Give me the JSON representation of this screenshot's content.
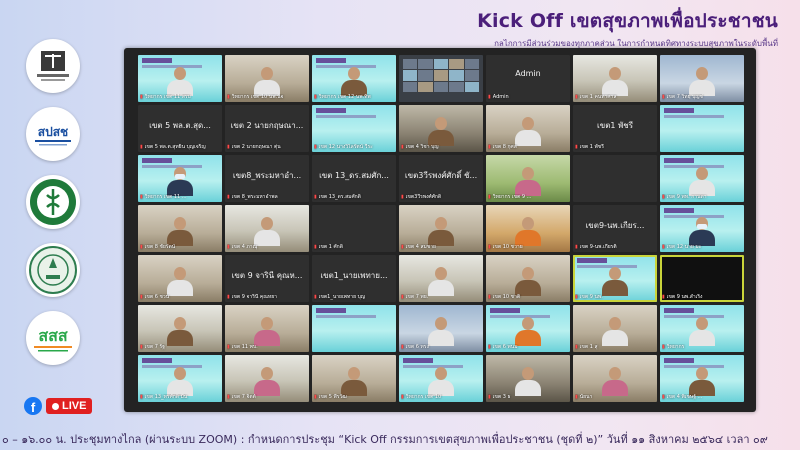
{
  "header": {
    "title": "Kick Off เขตสุขภาพเพื่อประชาชน",
    "subtitle": "กลไกการมีส่วนร่วมของทุกภาคส่วน ในการกำหนดทิศทางระบบสุขภาพในระดับพื้นที่"
  },
  "live": {
    "label": "LIVE"
  },
  "logos": [
    {
      "name": "national-health-commission-logo",
      "caption": "สำนักงานคณะกรรมการสุขภาพแห่งชาติ"
    },
    {
      "name": "nhso-logo",
      "caption": "สปสช"
    },
    {
      "name": "ministry-of-public-health-logo",
      "caption": ""
    },
    {
      "name": "bangkok-metropolitan-logo",
      "caption": ""
    },
    {
      "name": "thaihealth-logo",
      "caption": "สสส"
    }
  ],
  "tiles": [
    {
      "style": "kick",
      "cap": "วิทยากร เขต 11 สรบ",
      "person": "white"
    },
    {
      "style": "room",
      "cap": "วิทยากร เขต 10 นพ.นิจ",
      "person": "white"
    },
    {
      "style": "kick",
      "cap": "วิทยากร เขต 12 นพ.ทิพ",
      "person": "brown"
    },
    {
      "style": "gallery",
      "cap": "",
      "person": ""
    },
    {
      "style": "dark",
      "center": "Admin",
      "cap": "Admin",
      "person": ""
    },
    {
      "style": "office",
      "cap": "เขต 1 คนท่าศาล",
      "person": "white"
    },
    {
      "style": "blue",
      "cap": "เขต 7 วิทยฺ บุญช่",
      "person": "white"
    },
    {
      "style": "dark",
      "center": "เขต 5   พล.ต.สุด...",
      "cap": "เขต 5   พล.ต.สุทยิน บุญเจริญ",
      "person": ""
    },
    {
      "style": "dark",
      "center": "เขต 2 นายกฤษณา...",
      "cap": "เขต 2 นายกฤษณา ตุ่น",
      "person": ""
    },
    {
      "style": "kick",
      "cap": "เขต 12 นางวิไลรัตน์ วีระ",
      "person": ""
    },
    {
      "style": "meet",
      "cap": "เขต 4 วิชา บุญ",
      "person": "brown"
    },
    {
      "style": "room",
      "cap": "เขต 8 กุศล",
      "person": "white"
    },
    {
      "style": "dark",
      "center": "เขต1 พัชรี",
      "cap": "เขต 1 พัชรี",
      "person": ""
    },
    {
      "style": "kick",
      "cap": "",
      "person": ""
    },
    {
      "style": "kick",
      "cap": "วิทยากร เขต 11 ...",
      "person": "mask"
    },
    {
      "style": "dark",
      "center": "เขต8_พระมหาอำ...",
      "cap": "เขต 8_พระมหาอำพล",
      "person": ""
    },
    {
      "style": "dark",
      "center": "เขต 13_ดร.สมศัก...",
      "cap": "เขต 13_ดร.สมศักดิ์",
      "person": ""
    },
    {
      "style": "dark",
      "center": "เขต3วีรพงศ์ศักดิ์ ชั...",
      "cap": "เขต3วีรพงศ์ศักดิ์",
      "person": ""
    },
    {
      "style": "green",
      "cap": "วิทยากร เขต 9 ...",
      "person": "pink"
    },
    {
      "style": "dark",
      "cap": "",
      "person": ""
    },
    {
      "style": "kick",
      "cap": "เขต 9 พท. กานดา",
      "person": "white"
    },
    {
      "style": "room",
      "cap": "เขต 8 ชัยรัตน์",
      "person": "brown"
    },
    {
      "style": "office",
      "cap": "เขต 4 ภาณุ",
      "person": "white"
    },
    {
      "style": "dark",
      "cap": "เขต 1 ศักดิ์",
      "person": ""
    },
    {
      "style": "room",
      "cap": "เขต 4 สมชาย",
      "person": "brown"
    },
    {
      "style": "orange",
      "cap": "เขต 10 ชวาย",
      "person": "orange"
    },
    {
      "style": "dark",
      "center": "เขต9-นพ.เกียร...",
      "cap": "เขต 9-นพ.เกียรติ",
      "person": ""
    },
    {
      "style": "kick",
      "cap": "เขต 12 นาย มะ",
      "person": "mask"
    },
    {
      "style": "room",
      "cap": "เขต 6 ชวน",
      "person": "white"
    },
    {
      "style": "dark",
      "center": "เขต 9 จารินี คุณห...",
      "cap": "เขต 9 จารินี คุณหยา",
      "person": ""
    },
    {
      "style": "dark",
      "center": "เขต1_นายเพทาย...",
      "cap": "เขต1_นายเพทาย บุญ",
      "person": ""
    },
    {
      "style": "office",
      "cap": "เขต 7 พย.",
      "person": "white"
    },
    {
      "style": "room",
      "cap": "เขต 10 ชาติ",
      "person": "brown"
    },
    {
      "style": "kick",
      "cap": "เขต 9 นพ.",
      "person": "brown",
      "speaking": true
    },
    {
      "style": "black",
      "cap": "เขต 9 นพ.สำเริง",
      "person": "",
      "speaking": true
    },
    {
      "style": "office",
      "cap": "เขต 7 รัฐ",
      "person": "brown"
    },
    {
      "style": "room",
      "cap": "เขต 11 พบ.",
      "person": "pink"
    },
    {
      "style": "kick",
      "cap": "",
      "person": ""
    },
    {
      "style": "blue",
      "cap": "เขต 6 ทรง",
      "person": "white"
    },
    {
      "style": "kick",
      "cap": "เขต 6 พนม",
      "person": "orange"
    },
    {
      "style": "room",
      "cap": "เขต 1 สุ",
      "person": "white"
    },
    {
      "style": "kick",
      "cap": "วิทยากร",
      "person": "white"
    },
    {
      "style": "kick",
      "cap": "เขต 13_ทรศักดิ์ มีน",
      "person": "white"
    },
    {
      "style": "office",
      "cap": "เขต 7 จิตต์",
      "person": "pink"
    },
    {
      "style": "room",
      "cap": "เขต 5 พีรวัฒ",
      "person": "brown"
    },
    {
      "style": "kick",
      "cap": "วิทยากร เขต 10",
      "person": "white"
    },
    {
      "style": "meet",
      "cap": "เขต 3 ธ",
      "person": "white"
    },
    {
      "style": "room",
      "cap": "นัยนา",
      "person": "pink"
    },
    {
      "style": "kick",
      "cap": "เขต 4 พิเชษฐ์ ...",
      "person": "brown"
    }
  ],
  "ticker": "๐ – ๑๖.๐๐ น. ประชุมทางไกล (ผ่านระบบ ZOOM) : กำหนดการประชุม “Kick Off กรรมการเขตสุขภาพเพื่อประชาชน (ชุดที่ ๒)” วันที่ ๑๑ สิงหาคม ๒๕๖๔ เวลา ๐๙"
}
